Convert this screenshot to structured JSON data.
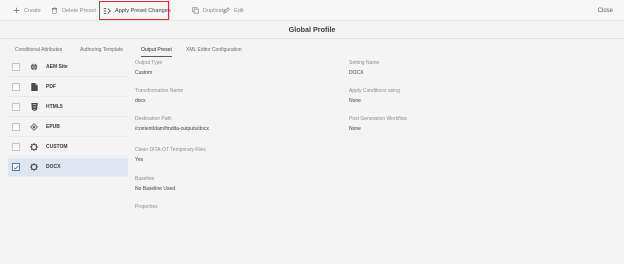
{
  "toolbar": {
    "create": "Create",
    "delete": "Delete Preset",
    "apply": "Apply Preset Changes",
    "duplicate": "Duplicate",
    "edit": "Edit",
    "close": "Close"
  },
  "header": {
    "title": "Global Profile"
  },
  "tabs": [
    "Conditional Attributes",
    "Authoring Template",
    "Output Preset",
    "XML Editor Configuration"
  ],
  "active_tab": "Output Preset",
  "presets": [
    {
      "label": "AEM Site",
      "icon": "globe-icon",
      "selected": false
    },
    {
      "label": "PDF",
      "icon": "document-icon",
      "selected": false
    },
    {
      "label": "HTML5",
      "icon": "html5-icon",
      "selected": false
    },
    {
      "label": "EPUB",
      "icon": "epub-icon",
      "selected": false
    },
    {
      "label": "CUSTOM",
      "icon": "gear-icon",
      "selected": false
    },
    {
      "label": "DOCX",
      "icon": "gear-icon",
      "selected": true
    }
  ],
  "fields_left": [
    {
      "label": "Output Type",
      "value": "Custom"
    },
    {
      "label": "Transformation Name",
      "value": "docx"
    },
    {
      "label": "Destination Path",
      "value": "/content/dam/fmdita-outputs/docx"
    },
    {
      "label": "Clean DITA-OT Temporary Files",
      "value": "Yes"
    },
    {
      "label": "Baseline",
      "value": "No Baseline Used"
    },
    {
      "label": "Properties",
      "value": ""
    }
  ],
  "fields_right": [
    {
      "label": "Setting Name",
      "value": "DOCX"
    },
    {
      "label": "Apply Conditions using",
      "value": "None"
    },
    {
      "label": "Post Generation Workflow",
      "value": "None"
    }
  ]
}
